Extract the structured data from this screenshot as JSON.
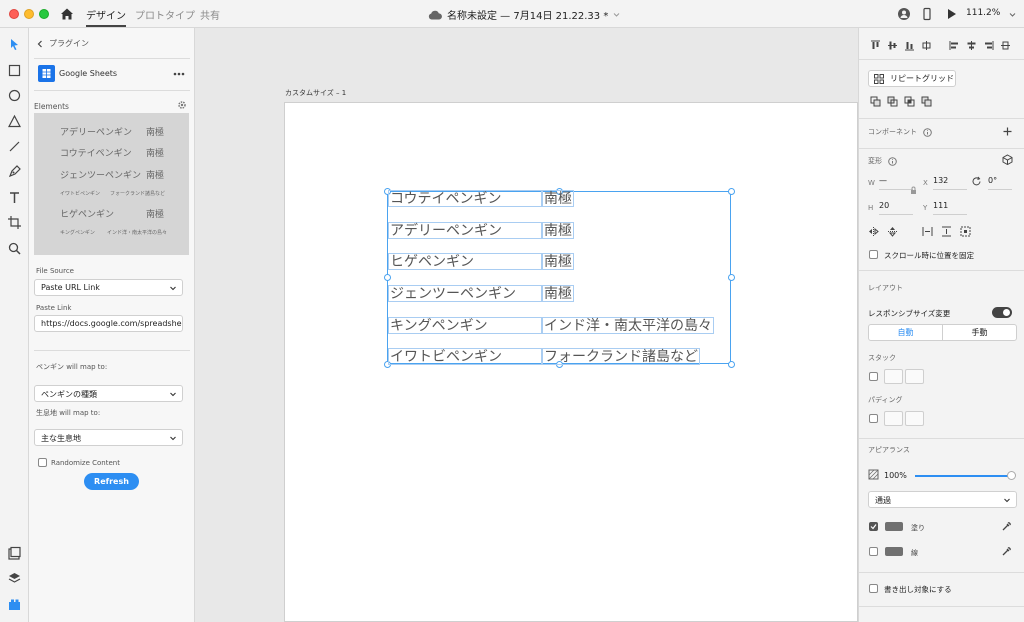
{
  "titlebar": {
    "tabs": [
      "デザイン",
      "プロトタイプ",
      "共有"
    ],
    "doc_title": "名称未設定 — 7月14日 21.22.33 *",
    "zoom": "111.2%"
  },
  "tools": [
    "select-arrow-icon",
    "rectangle-icon",
    "ellipse-icon",
    "polygon-icon",
    "line-icon",
    "pen-icon",
    "text-icon",
    "artboard-icon",
    "zoom-icon",
    "assets-icon",
    "layers-icon",
    "plugins-icon"
  ],
  "plugin": {
    "back_label": "プラグイン",
    "name": "Google Sheets",
    "elements_label": "Elements",
    "preview_rows": [
      {
        "left": "アデリーペンギン",
        "right": "南極",
        "size": "big"
      },
      {
        "left": "コウテイペンギン",
        "right": "南極",
        "size": "big"
      },
      {
        "left": "ジェンツーペンギン",
        "right": "南極",
        "size": "big"
      },
      {
        "left": "イワトビペンギン",
        "right": "フォークランド諸島など",
        "size": "small"
      },
      {
        "left": "ヒゲペンギン",
        "right": "南極",
        "size": "big"
      },
      {
        "left": "キングペンギン",
        "right": "インド洋・南太平洋の島々",
        "size": "small"
      }
    ],
    "file_source_label": "File Source",
    "file_source_value": "Paste URL Link",
    "paste_link_label": "Paste Link",
    "paste_link_value": "https://docs.google.com/spreadshe",
    "map1_label": "ペンギン will map to:",
    "map1_value": "ペンギンの種類",
    "map2_label": "生息地 will map to:",
    "map2_value": "主な生息地",
    "randomize_label": "Randomize Content",
    "refresh_label": "Refresh"
  },
  "canvas": {
    "artboard_label": "カスタムサイズ – 1",
    "rows": [
      {
        "name": "コウテイペンギン",
        "habitat": "南極"
      },
      {
        "name": "アデリーペンギン",
        "habitat": "南極"
      },
      {
        "name": "ヒゲペンギン",
        "habitat": "南極"
      },
      {
        "name": "ジェンツーペンギン",
        "habitat": "南極"
      },
      {
        "name": "キングペンギン",
        "habitat": "インド洋・南太平洋の島々"
      },
      {
        "name": "イワトビペンギン",
        "habitat": "フォークランド諸島など"
      }
    ]
  },
  "inspector": {
    "repeat_grid": "リピートグリッド",
    "component": "コンポーネント",
    "transform": "変形",
    "w_label": "W",
    "w_value": "—",
    "x_label": "X",
    "x_value": "132",
    "rotation_value": "0°",
    "h_label": "H",
    "h_value": "20",
    "y_label": "Y",
    "y_value": "111",
    "fix_scroll": "スクロール時に位置を固定",
    "layout": "レイアウト",
    "responsive": "レスポンシブサイズ変更",
    "auto": "自動",
    "manual": "手動",
    "stack": "スタック",
    "padding": "パディング",
    "appearance": "アピアランス",
    "opacity": "100%",
    "blend": "通過",
    "fill": "塗り",
    "border": "線",
    "export": "書き出し対象にする"
  }
}
